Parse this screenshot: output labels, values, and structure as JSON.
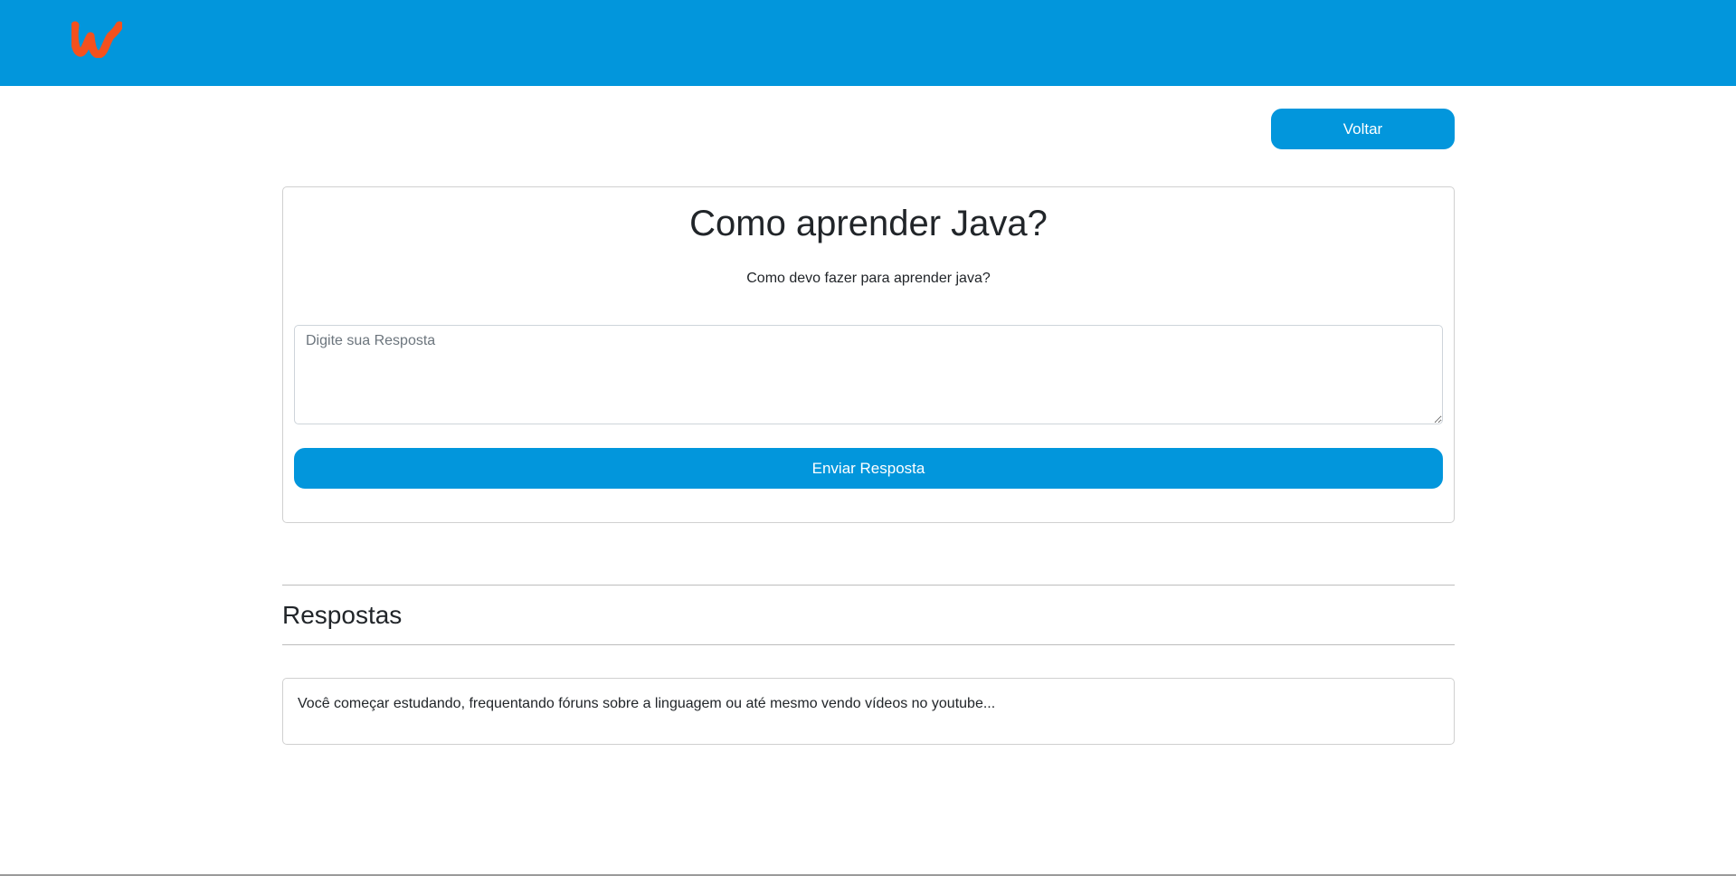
{
  "header": {
    "logo_icon": "wattpad-w-logo-icon",
    "background_color": "#0296dc",
    "logo_color": "#f4511e"
  },
  "nav": {
    "back_label": "Voltar"
  },
  "question": {
    "title": "Como aprender Java?",
    "body": "Como devo fazer para aprender java?"
  },
  "answer_form": {
    "placeholder": "Digite sua Resposta",
    "value": "",
    "submit_label": "Enviar Resposta"
  },
  "answers": {
    "heading": "Respostas",
    "items": [
      {
        "text": "Você começar estudando, frequentando fóruns sobre a linguagem ou até mesmo vendo vídeos no youtube..."
      }
    ]
  }
}
